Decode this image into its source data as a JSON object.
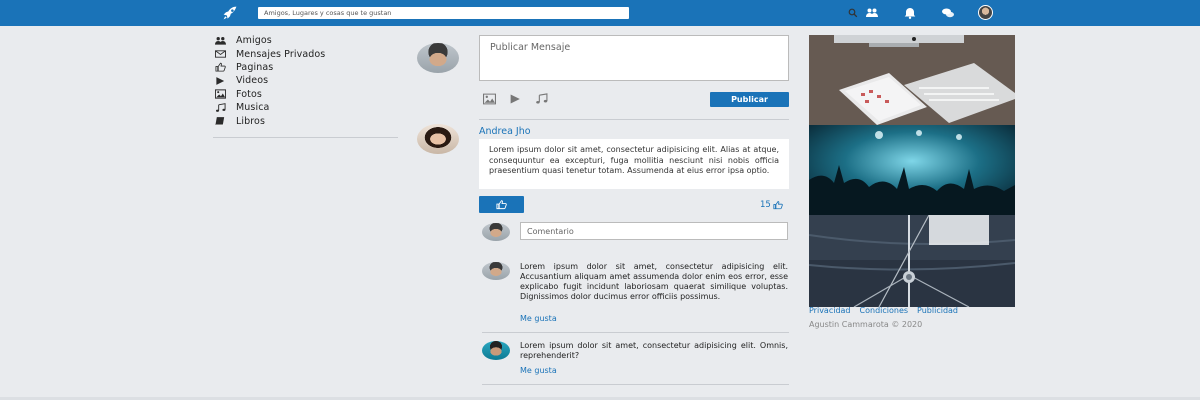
{
  "topbar": {
    "logo_icon": "rocket-icon",
    "search_placeholder": "Amigos, Lugares y cosas que te gustan",
    "search_icon": "search-icon",
    "icons": [
      "friends-icon",
      "bell-icon",
      "chat-icon"
    ],
    "brand_color": "#1a73b8"
  },
  "sidebar": {
    "items": [
      {
        "label": "Amigos",
        "icon": "users-icon"
      },
      {
        "label": "Mensajes Privados",
        "icon": "envelope-icon"
      },
      {
        "label": "Paginas",
        "icon": "thumbs-up-icon"
      },
      {
        "label": "Videos",
        "icon": "play-icon"
      },
      {
        "label": "Fotos",
        "icon": "image-icon"
      },
      {
        "label": "Musica",
        "icon": "music-icon"
      },
      {
        "label": "Libros",
        "icon": "book-icon"
      }
    ]
  },
  "composer": {
    "placeholder": "Publicar Mensaje",
    "publish_label": "Publicar",
    "media_icons": [
      "image-icon",
      "play-icon",
      "music-icon"
    ]
  },
  "post": {
    "author": "Andrea Jho",
    "text": "Lorem ipsum dolor sit amet, consectetur adipisicing elit. Alias at atque, consequuntur ea excepturi, fuga mollitia nesciunt nisi nobis officia praesentium quasi tenetur totam. Assumenda at eius error ipsa optio.",
    "like_count": "15",
    "comment_placeholder": "Comentario"
  },
  "comments": [
    {
      "text": "Lorem ipsum dolor sit amet, consectetur adipisicing elit. Accusantium aliquam amet assumenda dolor enim eos error, esse explicabo fugit incidunt laboriosam quaerat similique voluptas. Dignissimos dolor ducimus error officiis possimus.",
      "like_label": "Me gusta"
    },
    {
      "text": "Lorem ipsum dolor sit amet, consectetur adipisicing elit. Omnis, reprehenderit?",
      "like_label": "Me gusta"
    }
  ],
  "footer": {
    "links": [
      "Privacidad",
      "Condiciones",
      "Publicidad"
    ],
    "copyright": "Agustin Cammarota © 2020"
  }
}
